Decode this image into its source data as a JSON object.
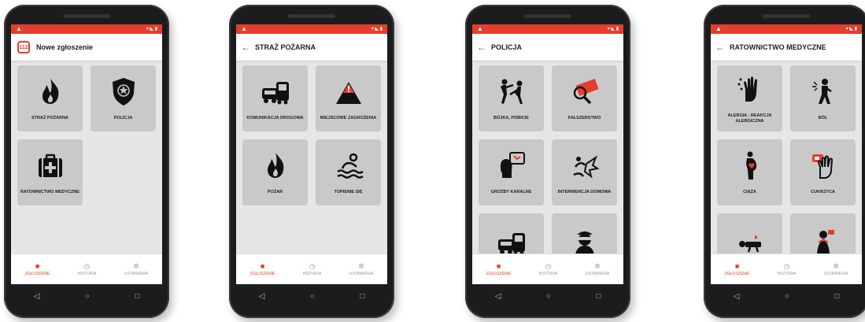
{
  "accent_color": "#e53e2c",
  "phones": [
    {
      "title": "Nowe zgłoszenie",
      "show_back": false,
      "show_logo": true,
      "tiles": [
        {
          "label": "STRAŻ POŻARNA",
          "icon": "fire-icon"
        },
        {
          "label": "POLICJA",
          "icon": "police-badge-icon"
        },
        {
          "label": "RATOWNICTWO MEDYCZNE",
          "icon": "medical-kit-icon"
        }
      ],
      "active_nav": 0
    },
    {
      "title": "STRAŻ POŻARNA",
      "show_back": true,
      "show_logo": false,
      "tiles": [
        {
          "label": "KOMUNIKACJA DROGOWA",
          "icon": "vehicles-icon"
        },
        {
          "label": "MIEJSCOWE ZAGROŻENIA",
          "icon": "warning-mountain-icon"
        },
        {
          "label": "POŻAR",
          "icon": "fire-icon"
        },
        {
          "label": "TOPIENIE SIĘ",
          "icon": "drowning-icon"
        }
      ],
      "active_nav": 0
    },
    {
      "title": "POLICJA",
      "show_back": true,
      "show_logo": false,
      "tiles": [
        {
          "label": "BÓJKA, POBICIE",
          "icon": "fight-icon"
        },
        {
          "label": "FAŁSZERSTWO",
          "icon": "counterfeit-icon"
        },
        {
          "label": "GROŹBY KARALNE",
          "icon": "threat-icon"
        },
        {
          "label": "INTERWENCJA DOMOWA",
          "icon": "domestic-icon"
        },
        {
          "label": "",
          "icon": "vehicles-icon"
        },
        {
          "label": "",
          "icon": "thief-icon"
        }
      ],
      "active_nav": 0
    },
    {
      "title": "RATOWNICTWO MEDYCZNE",
      "show_back": true,
      "show_logo": false,
      "tiles": [
        {
          "label": "ALERGIA - REAKCJA ALERGICZNA",
          "icon": "allergy-hand-icon"
        },
        {
          "label": "BÓL",
          "icon": "pain-icon"
        },
        {
          "label": "CIĄŻA",
          "icon": "pregnancy-icon"
        },
        {
          "label": "CUKRZYCA",
          "icon": "diabetes-icon"
        },
        {
          "label": "",
          "icon": "lying-person-icon"
        },
        {
          "label": "",
          "icon": "choking-icon"
        }
      ],
      "active_nav": 0
    }
  ],
  "nav_items": [
    {
      "label": "ZGŁOSZENIE",
      "icon": "report-icon"
    },
    {
      "label": "HISTORIA",
      "icon": "history-icon"
    },
    {
      "label": "USTAWIENIA",
      "icon": "settings-icon"
    }
  ]
}
